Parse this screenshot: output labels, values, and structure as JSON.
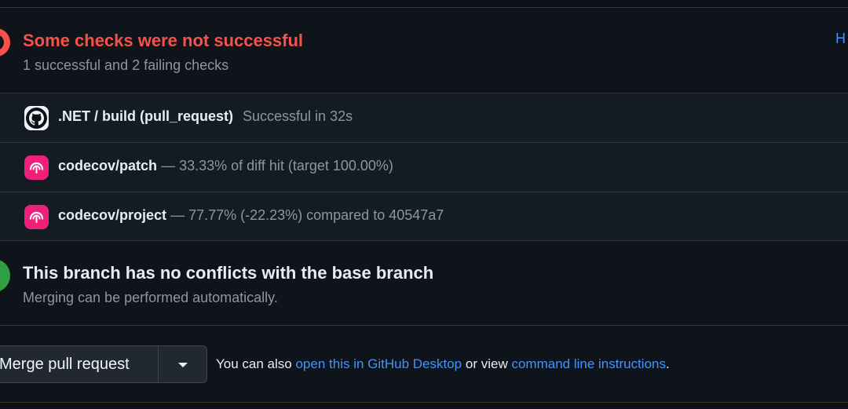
{
  "checks_section": {
    "title": "Some checks were not successful",
    "summary": "1 successful and 2 failing checks",
    "hide_link": "H",
    "status_colors": {
      "failure": "#f85149",
      "success": "#3fb950"
    },
    "items": [
      {
        "icon": "github-icon",
        "name": ".NET / build (pull_request)",
        "status": "Successful in 32s"
      },
      {
        "icon": "codecov-icon",
        "name": "codecov/patch",
        "status": "— 33.33% of diff hit (target 100.00%)"
      },
      {
        "icon": "codecov-icon",
        "name": "codecov/project",
        "status": "— 77.77% (-22.23%) compared to 40547a7"
      }
    ]
  },
  "conflicts_section": {
    "title": "This branch has no conflicts with the base branch",
    "subtitle": "Merging can be performed automatically."
  },
  "merge_section": {
    "button_label": "Merge pull request",
    "caret_icon": "triangle-down-icon",
    "text_prefix": "You can also",
    "desktop_link": "open this in GitHub Desktop",
    "text_middle": "or view",
    "cli_link": "command line instructions",
    "text_suffix": "."
  }
}
